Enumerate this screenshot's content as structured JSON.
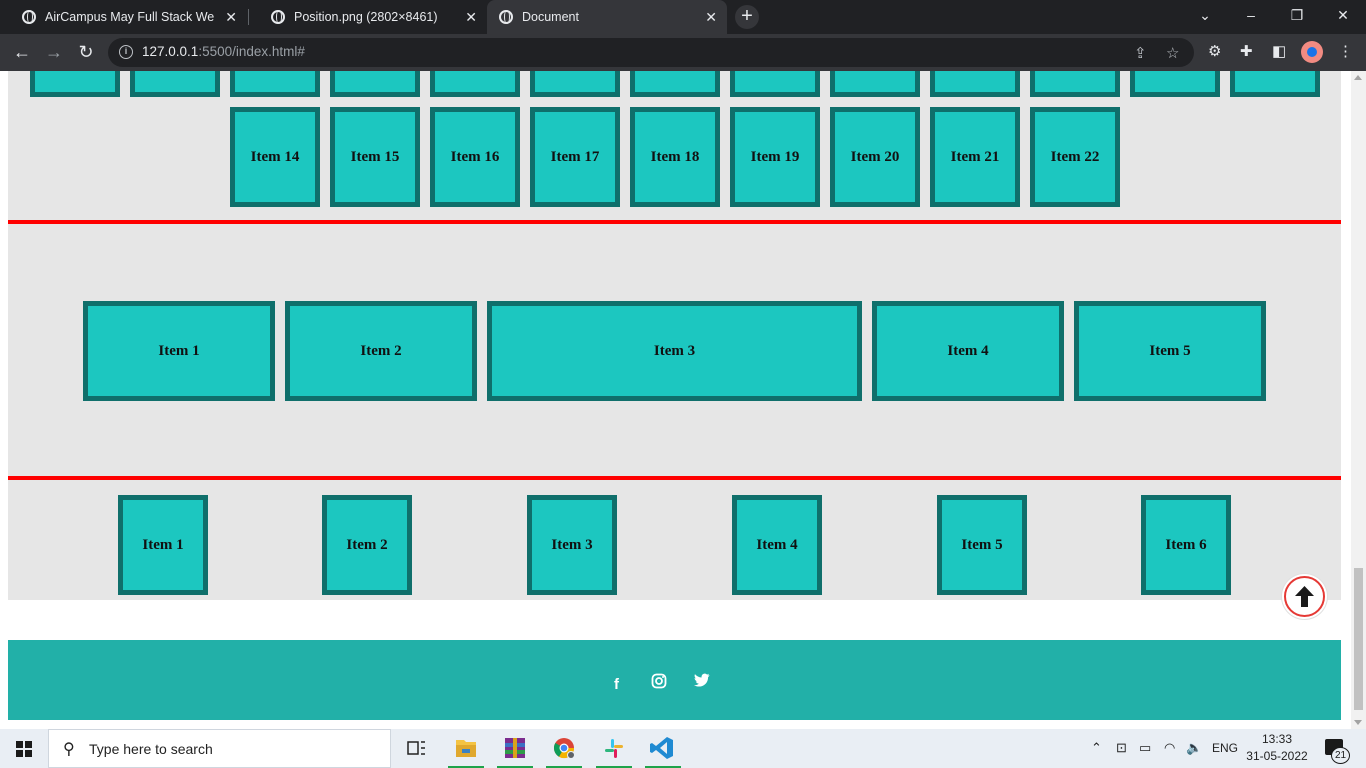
{
  "browser": {
    "tabs": [
      {
        "title": "AirCampus May Full Stack Web D"
      },
      {
        "title": "Position.png (2802×8461)"
      },
      {
        "title": "Document"
      }
    ],
    "url_host": "127.0.0.1",
    "url_rest": ":5500/index.html#"
  },
  "page": {
    "row1_items": [
      "Item 14",
      "Item 15",
      "Item 16",
      "Item 17",
      "Item 18",
      "Item 19",
      "Item 20",
      "Item 21",
      "Item 22"
    ],
    "flex_items": [
      "Item 1",
      "Item 2",
      "Item 3",
      "Item 4",
      "Item 5"
    ],
    "space_items": [
      "Item 1",
      "Item 2",
      "Item 3",
      "Item 4",
      "Item 5",
      "Item 6"
    ],
    "colors": {
      "box_fill": "#1cc7c0",
      "box_border": "#0f6f6b",
      "divider": "#ff0000",
      "section_bg": "#e6e6e6",
      "footer_bg": "#22b0a8"
    },
    "footer_icons": [
      "facebook-icon",
      "instagram-icon",
      "twitter-icon"
    ]
  },
  "taskbar": {
    "search_placeholder": "Type here to search",
    "lang": "ENG",
    "time": "13:33",
    "date": "31-05-2022",
    "notifications": "21"
  }
}
